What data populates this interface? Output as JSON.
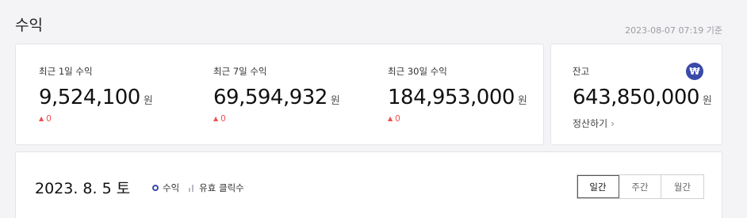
{
  "header": {
    "title": "수익",
    "timestamp": "2023-08-07 07:19 기준"
  },
  "stats": [
    {
      "label": "최근 1일 수익",
      "value": "9,524,100",
      "unit": "원",
      "change": "0"
    },
    {
      "label": "최근 7일 수익",
      "value": "69,594,932",
      "unit": "원",
      "change": "0"
    },
    {
      "label": "최근 30일 수익",
      "value": "184,953,000",
      "unit": "원",
      "change": "0"
    }
  ],
  "balance": {
    "label": "잔고",
    "value": "643,850,000",
    "unit": "원",
    "icon_glyph": "₩",
    "icon": "won-icon",
    "settle_label": "정산하기"
  },
  "chart": {
    "date": "2023. 8. 5 토",
    "legend": [
      {
        "label": "수익",
        "icon": "circle-marker"
      },
      {
        "label": "유효 클릭수",
        "icon": "bar-marker"
      }
    ],
    "tabs": [
      {
        "label": "일간",
        "active": true
      },
      {
        "label": "주간",
        "active": false
      },
      {
        "label": "월간",
        "active": false
      }
    ]
  },
  "colors": {
    "accent": "#3a4aa8",
    "up": "#f0504f",
    "background": "#f4f4f6"
  }
}
